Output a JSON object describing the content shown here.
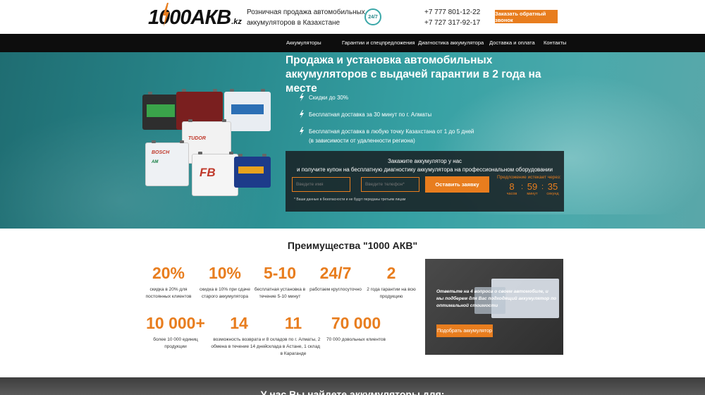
{
  "header": {
    "logo_text": "1000АКВ",
    "logo_suffix": ".kz",
    "tagline": "Розничная продажа автомобильных аккумуляторов в Казахстане",
    "badge": "24/7",
    "phone_1": "+7 777 801-12-22",
    "phone_2": "+7 727 317-92-17",
    "callback_button": "Заказать обратный звонок"
  },
  "nav": {
    "items": [
      {
        "label": "Аккумуляторы"
      },
      {
        "label": "Гарантии и спецпредложения"
      },
      {
        "label": "Диагностика аккумулятора"
      },
      {
        "label": "Доставка и оплата"
      },
      {
        "label": "Контакты"
      }
    ]
  },
  "hero": {
    "title": "Продажа и установка автомобильных аккумуляторов с выдачей гарантии в 2 года на месте",
    "features": [
      "Скидки до 30%",
      "Бесплатная доставка за 30 минут по г. Алматы",
      "Бесплатная доставка в любую точку Казахстана от 1 до 5 дней",
      "(в зависимости от удаленности региона)"
    ],
    "battery_brands": [
      "TUDOR",
      "BOSCH",
      "FB",
      "AM"
    ]
  },
  "form": {
    "title_line1": "Закажите аккумулятор у нас",
    "title_line2": "и получите купон на бесплатную диагностику аккумулятора на профессиональном оборудовании",
    "name_placeholder": "Введите имя",
    "phone_placeholder": "Введите телефон*",
    "submit_button": "Оставить заявку",
    "timer_label": "Предложение истекает через:",
    "timer": {
      "hours": "8",
      "minutes": "59",
      "seconds": "35",
      "hours_unit": "часов",
      "minutes_unit": "минут",
      "seconds_unit": "секунд",
      "sep": ":"
    },
    "privacy": "* Ваши данные в безопасности и не будут переданы третьим лицам"
  },
  "advantages": {
    "title": "Преимущества \"1000 АКВ\"",
    "items": [
      {
        "value": "20%",
        "text": "скидка в 20% для постоянных клиентов"
      },
      {
        "value": "10%",
        "text": "скидка в 10% при сдаче старого аккумулятора"
      },
      {
        "value": "5-10",
        "text": "бесплатная установка в течение 5-10 минут"
      },
      {
        "value": "24/7",
        "text": "работаем круглосуточно"
      },
      {
        "value": "2",
        "text": "2 года гарантии на всю продукцию"
      },
      {
        "value": "10 000+",
        "text": "более 10 000 единиц продукции"
      },
      {
        "value": "14",
        "text": "возможность возврата и обмена в течение 14 дней"
      },
      {
        "value": "11",
        "text": "8 складов по г. Алматы, 2 склада в Астане, 1 склад в Караганде"
      },
      {
        "value": "70 000",
        "text": "70 000 довольных клиентов"
      }
    ]
  },
  "promo": {
    "text": "Ответьте на 4 вопроса о своем автомобиле, и мы подберем для Вас подходящий аккумулятор по оптимальной стоимости",
    "button": "Подобрать аккумулятор"
  },
  "bottom": {
    "title": "У нас Вы найдете аккумуляторы для:"
  },
  "colors": {
    "accent": "#e87d1e",
    "nav_bg": "#0d0d0d",
    "hero_teal": "#2a8c90",
    "panel_bg": "#192528"
  }
}
